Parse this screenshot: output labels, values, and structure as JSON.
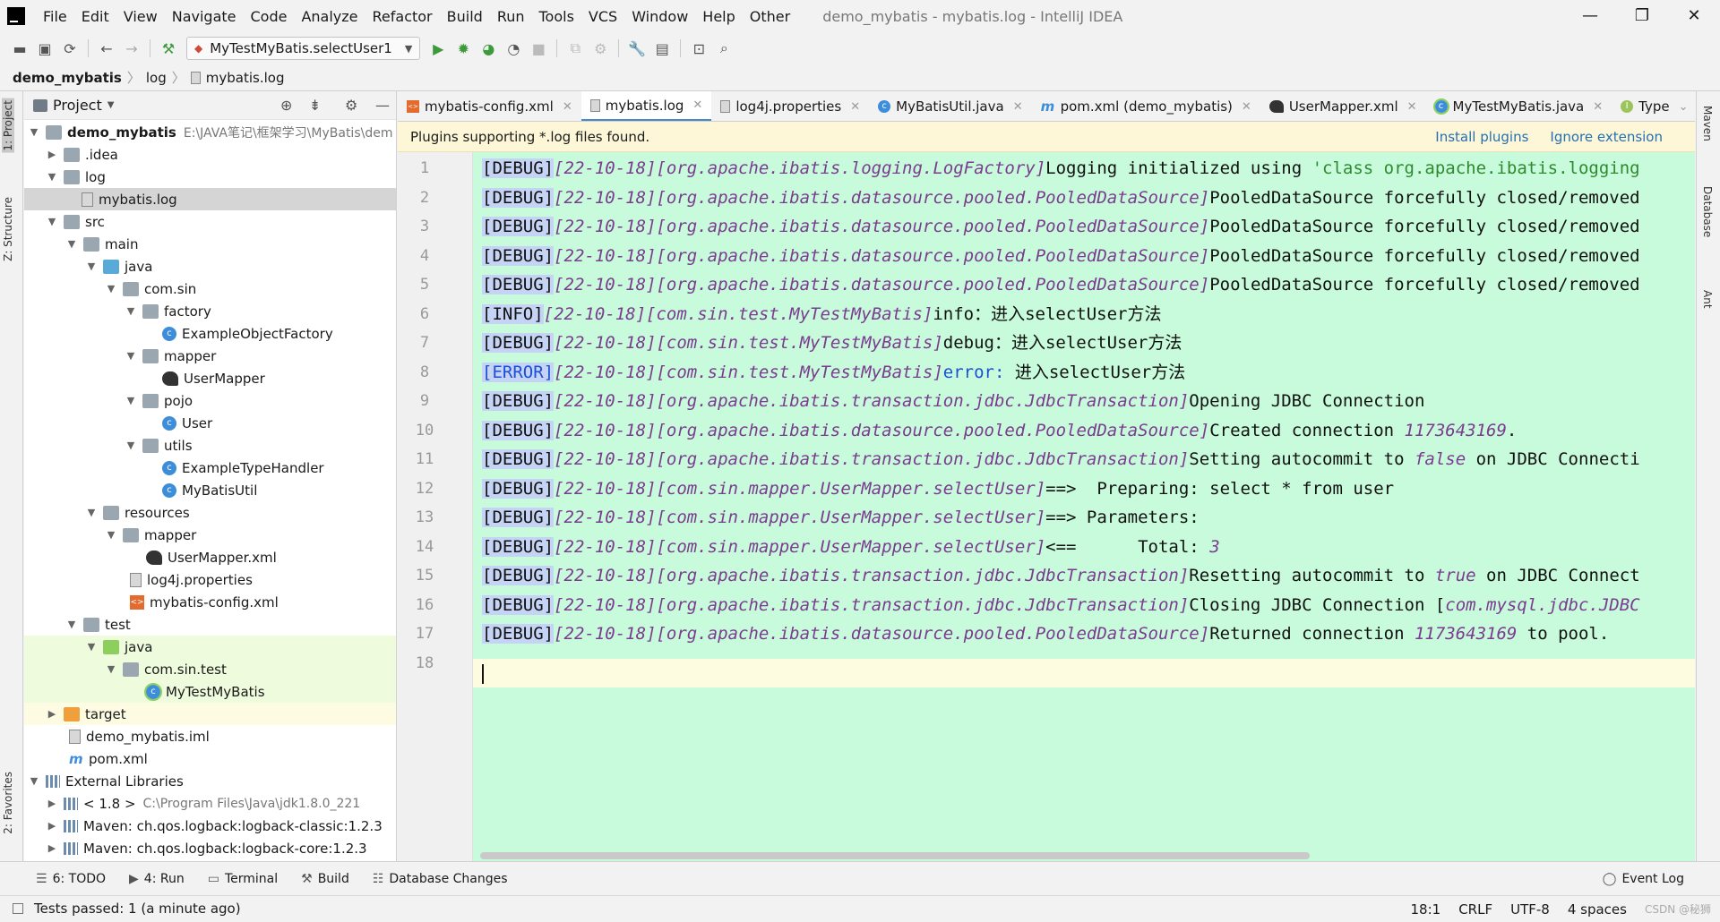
{
  "menu": {
    "items": [
      "File",
      "Edit",
      "View",
      "Navigate",
      "Code",
      "Analyze",
      "Refactor",
      "Build",
      "Run",
      "Tools",
      "VCS",
      "Window",
      "Help",
      "Other"
    ],
    "window_title": "demo_mybatis - mybatis.log - IntelliJ IDEA"
  },
  "toolbar": {
    "run_config": "MyTestMyBatis.selectUser1"
  },
  "breadcrumb": {
    "project": "demo_mybatis",
    "folder": "log",
    "file": "mybatis.log"
  },
  "left_stripe": {
    "project": "1: Project",
    "structure": "Z: Structure",
    "favorites": "2: Favorites"
  },
  "right_stripe": {
    "maven": "Maven",
    "database": "Database",
    "ant": "Ant"
  },
  "project_panel": {
    "title": "Project",
    "tree": [
      {
        "label": "demo_mybatis",
        "path": "E:\\JAVA笔记\\框架学习\\MyBatis\\dem",
        "bold": true
      },
      {
        "label": ".idea"
      },
      {
        "label": "log"
      },
      {
        "label": "mybatis.log"
      },
      {
        "label": "src"
      },
      {
        "label": "main"
      },
      {
        "label": "java"
      },
      {
        "label": "com.sin"
      },
      {
        "label": "factory"
      },
      {
        "label": "ExampleObjectFactory"
      },
      {
        "label": "mapper"
      },
      {
        "label": "UserMapper"
      },
      {
        "label": "pojo"
      },
      {
        "label": "User"
      },
      {
        "label": "utils"
      },
      {
        "label": "ExampleTypeHandler"
      },
      {
        "label": "MyBatisUtil"
      },
      {
        "label": "resources"
      },
      {
        "label": "mapper"
      },
      {
        "label": "UserMapper.xml"
      },
      {
        "label": "log4j.properties"
      },
      {
        "label": "mybatis-config.xml"
      },
      {
        "label": "test"
      },
      {
        "label": "java"
      },
      {
        "label": "com.sin.test"
      },
      {
        "label": "MyTestMyBatis"
      },
      {
        "label": "target"
      },
      {
        "label": "demo_mybatis.iml"
      },
      {
        "label": "pom.xml"
      },
      {
        "label": "External Libraries"
      },
      {
        "label": "< 1.8 >",
        "path": "C:\\Program Files\\Java\\jdk1.8.0_221"
      },
      {
        "label": "Maven: ch.qos.logback:logback-classic:1.2.3"
      },
      {
        "label": "Maven: ch.qos.logback:logback-core:1.2.3"
      }
    ]
  },
  "tabs": [
    {
      "label": "mybatis-config.xml",
      "active": false
    },
    {
      "label": "mybatis.log",
      "active": true
    },
    {
      "label": "log4j.properties",
      "active": false
    },
    {
      "label": "MyBatisUtil.java",
      "active": false
    },
    {
      "label": "pom.xml (demo_mybatis)",
      "active": false
    },
    {
      "label": "UserMapper.xml",
      "active": false
    },
    {
      "label": "MyTestMyBatis.java",
      "active": false
    },
    {
      "label": "Type",
      "active": false
    }
  ],
  "banner": {
    "message": "Plugins supporting *.log files found.",
    "install": "Install plugins",
    "ignore": "Ignore extension"
  },
  "editor": {
    "lines": [
      {
        "n": "1",
        "tag": "[DEBUG]",
        "date": "[22-10-18]",
        "logger": "[org.apache.ibatis.logging.LogFactory]",
        "msg": "Logging initialized using ",
        "str": "'class org.apache.ibatis.logging"
      },
      {
        "n": "2",
        "tag": "[DEBUG]",
        "date": "[22-10-18]",
        "logger": "[org.apache.ibatis.datasource.pooled.PooledDataSource]",
        "msg": "PooledDataSource forcefully closed/removed"
      },
      {
        "n": "3",
        "tag": "[DEBUG]",
        "date": "[22-10-18]",
        "logger": "[org.apache.ibatis.datasource.pooled.PooledDataSource]",
        "msg": "PooledDataSource forcefully closed/removed"
      },
      {
        "n": "4",
        "tag": "[DEBUG]",
        "date": "[22-10-18]",
        "logger": "[org.apache.ibatis.datasource.pooled.PooledDataSource]",
        "msg": "PooledDataSource forcefully closed/removed"
      },
      {
        "n": "5",
        "tag": "[DEBUG]",
        "date": "[22-10-18]",
        "logger": "[org.apache.ibatis.datasource.pooled.PooledDataSource]",
        "msg": "PooledDataSource forcefully closed/removed"
      },
      {
        "n": "6",
        "tag": "[INFO]",
        "date": "[22-10-18]",
        "logger": "[com.sin.test.MyTestMyBatis]",
        "msg": "info：进入selectUser方法"
      },
      {
        "n": "7",
        "tag": "[DEBUG]",
        "date": "[22-10-18]",
        "logger": "[com.sin.test.MyTestMyBatis]",
        "msg": "debug：进入selectUser方法"
      },
      {
        "n": "8",
        "tag": "[ERROR]",
        "date": "[22-10-18]",
        "logger": "[com.sin.test.MyTestMyBatis]",
        "kw": "error:",
        "msg": " 进入selectUser方法"
      },
      {
        "n": "9",
        "tag": "[DEBUG]",
        "date": "[22-10-18]",
        "logger": "[org.apache.ibatis.transaction.jdbc.JdbcTransaction]",
        "msg": "Opening JDBC Connection"
      },
      {
        "n": "10",
        "tag": "[DEBUG]",
        "date": "[22-10-18]",
        "logger": "[org.apache.ibatis.datasource.pooled.PooledDataSource]",
        "msg": "Created connection ",
        "num": "1173643169",
        "tail": "."
      },
      {
        "n": "11",
        "tag": "[DEBUG]",
        "date": "[22-10-18]",
        "logger": "[org.apache.ibatis.transaction.jdbc.JdbcTransaction]",
        "msg": "Setting autocommit to ",
        "num": "false",
        "tail": " on JDBC Connecti"
      },
      {
        "n": "12",
        "tag": "[DEBUG]",
        "date": "[22-10-18]",
        "logger": "[com.sin.mapper.UserMapper.selectUser]",
        "msg": "==>  Preparing: select * from user"
      },
      {
        "n": "13",
        "tag": "[DEBUG]",
        "date": "[22-10-18]",
        "logger": "[com.sin.mapper.UserMapper.selectUser]",
        "msg": "==> Parameters: "
      },
      {
        "n": "14",
        "tag": "[DEBUG]",
        "date": "[22-10-18]",
        "logger": "[com.sin.mapper.UserMapper.selectUser]",
        "msg": "<==      Total: ",
        "num": "3"
      },
      {
        "n": "15",
        "tag": "[DEBUG]",
        "date": "[22-10-18]",
        "logger": "[org.apache.ibatis.transaction.jdbc.JdbcTransaction]",
        "msg": "Resetting autocommit to ",
        "num": "true",
        "tail": " on JDBC Connect"
      },
      {
        "n": "16",
        "tag": "[DEBUG]",
        "date": "[22-10-18]",
        "logger": "[org.apache.ibatis.transaction.jdbc.JdbcTransaction]",
        "msg": "Closing JDBC Connection [",
        "num": "com.mysql.jdbc.JDBC"
      },
      {
        "n": "17",
        "tag": "[DEBUG]",
        "date": "[22-10-18]",
        "logger": "[org.apache.ibatis.datasource.pooled.PooledDataSource]",
        "msg": "Returned connection ",
        "num": "1173643169",
        "tail": " to pool."
      },
      {
        "n": "18"
      }
    ]
  },
  "bottom_tools": {
    "todo": "6: TODO",
    "run": "4: Run",
    "terminal": "Terminal",
    "build": "Build",
    "db_changes": "Database Changes",
    "event_log": "Event Log"
  },
  "status": {
    "message": "Tests passed: 1 (a minute ago)",
    "position": "18:1",
    "line_sep": "CRLF",
    "encoding": "UTF-8",
    "indent": "4 spaces",
    "watermark": "CSDN @秘狮"
  },
  "colors": {
    "editor_bg": "#c7fbdb",
    "tag_bg": "#c5d4f5",
    "accent": "#4a88c7"
  }
}
